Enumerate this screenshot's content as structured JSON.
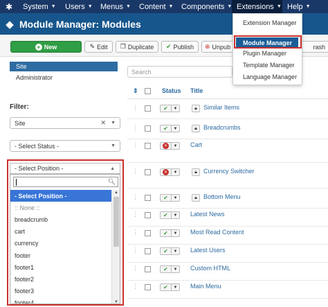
{
  "navbar": {
    "items": [
      {
        "label": "System"
      },
      {
        "label": "Users"
      },
      {
        "label": "Menus"
      },
      {
        "label": "Content"
      },
      {
        "label": "Components"
      },
      {
        "label": "Extensions"
      },
      {
        "label": "Help"
      }
    ]
  },
  "header": {
    "title": "Module Manager: Modules"
  },
  "toolbar": {
    "new_label": "New",
    "edit_label": "Edit",
    "duplicate_label": "Duplicate",
    "publish_label": "Publish",
    "unpublish_label": "Unpub",
    "trash_label": "rash"
  },
  "extensions_menu": {
    "items": [
      "Extension Manager",
      "Module Manager",
      "Plugin Manager",
      "Template Manager",
      "Language Manager"
    ],
    "highlighted": "Module Manager"
  },
  "sidebar": {
    "links": [
      {
        "label": "Site",
        "active": true
      },
      {
        "label": "Administrator",
        "active": false
      }
    ],
    "filter_label": "Filter:",
    "client_select": "Site",
    "status_select": "- Select Status -",
    "position_select": "- Select Position -"
  },
  "position_dropdown": {
    "search_value": "",
    "options": [
      "- Select Position -",
      ":: None ::",
      "breadcrumb",
      "cart",
      "currency",
      "footer",
      "footer1",
      "footer2",
      "footer3",
      "footer4"
    ],
    "selected": "- Select Position -"
  },
  "table": {
    "search_placeholder": "Search",
    "headers": {
      "status": "Status",
      "title": "Title"
    },
    "rows": [
      {
        "title": "Similar Items",
        "published": true,
        "locked": true
      },
      {
        "title": "Breadcrumbs",
        "published": true,
        "locked": true
      },
      {
        "title": "Cart",
        "published": false,
        "locked": false
      },
      {
        "title": "Currency Switcher",
        "published": false,
        "locked": true
      },
      {
        "title": "Bottom Menu",
        "published": true,
        "locked": true
      },
      {
        "title": "Latest News",
        "published": true,
        "locked": false
      },
      {
        "title": "Most Read Content",
        "published": true,
        "locked": false
      },
      {
        "title": "Latest Users",
        "published": true,
        "locked": false
      },
      {
        "title": "Custom HTML",
        "published": true,
        "locked": false
      },
      {
        "title": "Main Menu",
        "published": true,
        "locked": false
      }
    ]
  },
  "colors": {
    "navbar": "#1a3867",
    "header": "#17568c",
    "new_button": "#2f9e44",
    "highlight": "#3875d7",
    "annotation_red": "#c9302c"
  }
}
